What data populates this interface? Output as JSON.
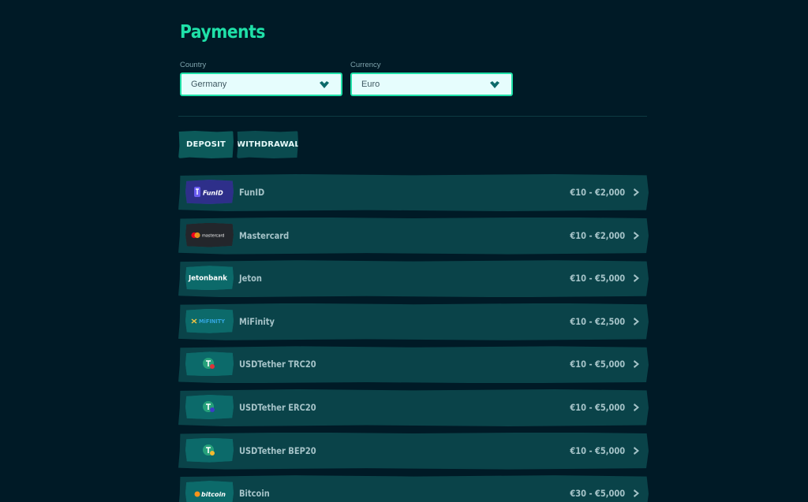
{
  "page": {
    "title": "Payments"
  },
  "filters": {
    "country_label": "Country",
    "country_value": "Germany",
    "currency_label": "Currency",
    "currency_value": "Euro"
  },
  "tabs": [
    {
      "label": "DEPOSIT",
      "active": true
    },
    {
      "label": "WITHDRAWAL",
      "active": false
    }
  ],
  "methods": [
    {
      "name": "FunID",
      "limit": "€10 - €2,000",
      "logo_text": "FunID",
      "icon": "funid-logo"
    },
    {
      "name": "Mastercard",
      "limit": "€10 - €2,000",
      "logo_text": "mastercard",
      "icon": "mastercard-logo"
    },
    {
      "name": "Jeton",
      "limit": "€10 - €5,000",
      "logo_text": "Jetonbank",
      "icon": "jetonbank-logo"
    },
    {
      "name": "MiFinity",
      "limit": "€10 - €2,500",
      "logo_text": "MiFINITY",
      "icon": "mifinity-logo"
    },
    {
      "name": "USDTether TRC20",
      "limit": "€10 - €5,000",
      "logo_text": "",
      "icon": "tether-trc20-logo"
    },
    {
      "name": "USDTether ERC20",
      "limit": "€10 - €5,000",
      "logo_text": "",
      "icon": "tether-erc20-logo"
    },
    {
      "name": "USDTether BEP20",
      "limit": "€10 - €5,000",
      "logo_text": "",
      "icon": "tether-bep20-logo"
    },
    {
      "name": "Bitcoin",
      "limit": "€30 - €5,000",
      "logo_text": "bitcoin",
      "icon": "bitcoin-logo"
    }
  ],
  "colors": {
    "background": "#001a26",
    "accent": "#1fe0a8",
    "row_background": "#0a4349",
    "logo_background": "#0c6a6a",
    "text_muted": "#a5c3c8",
    "select_background": "#e6fdfd"
  }
}
